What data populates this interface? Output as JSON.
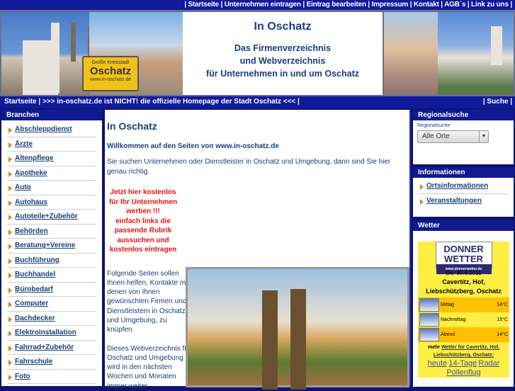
{
  "topnav": [
    "Startseite",
    "Unternehmen eintragen",
    "Eintrag bearbeiten",
    "Impressum",
    "Kontakt",
    "AGB´s",
    "Link zu uns"
  ],
  "header": {
    "title": "In Oschatz",
    "line1": "Das Firmenverzeichnis",
    "line2": "und Webverzeichnis",
    "line3": "für Unternehmen in und um Oschatz",
    "sign_top": "Große Kreisstadt",
    "sign_main": "Oschatz",
    "sign_url": "www.in-oschatz.de"
  },
  "subnav": {
    "home": "Startseite",
    "notice": ">>> in-oschatz.de ist NICHT! die offizielle Homepage der Stadt Oschatz <<<",
    "search": "Suche"
  },
  "branchen": {
    "title": "Branchen",
    "items": [
      "Abschleppdienst",
      "Ärzte",
      "Altenpflege",
      "Apotheke",
      "Auto",
      "Autohaus",
      "Autoteile+Zubehör",
      "Behörden",
      "Beratung+Vereine",
      "Buchführung",
      "Buchhandel",
      "Bürobedarf",
      "Computer",
      "Dachdecker",
      "Elektroinstallation",
      "Fahrrad+Zubehör",
      "Fahrschule",
      "Foto"
    ]
  },
  "main": {
    "title": "In Oschatz",
    "welcome": "Willkommen auf den Seiten von www.in-oschatz.de",
    "intro": "Sie suchen Unternehmen oder Dienstleister in Oschatz und Umgebung, dann sind Sie hier genau richtig.",
    "promo": [
      "Jetzt hier kostenlos",
      "für Ihr Unternehmen",
      "werben !!!",
      "einfach links die",
      "passende Rubrik",
      "aussuchen und",
      "kostenlos eintragen"
    ],
    "para1": "Folgende Seiten sollen Ihnen helfen, Kontakte mit denen von Ihnen gewünschten Firmen und Dienstleistern in Oschatz und Umgebung, zu knüpfen.",
    "para2": "Dieses Webverzeichnis für Oschatz und Umgebung wird in den nächsten Wochen und Monaten immer weiter"
  },
  "regional": {
    "title": "Regionalsuche",
    "label": "Regionalsuche",
    "selected": "Alle Orte"
  },
  "info": {
    "title": "Informationen",
    "items": [
      "Ortsinformationen",
      "Veranstaltungen"
    ]
  },
  "wetter": {
    "title": "Wetter",
    "logo1": "DONNER",
    "logo2": "WETTER",
    "logo_url": "www.donnerwetter.de",
    "date": "Do. 30.6.2011",
    "place": "Cavertitz, Hof, Liebschützberg, Oschatz",
    "rows": [
      {
        "label": "Mittag",
        "temp": "14°C"
      },
      {
        "label": "Nachmittag",
        "temp": "15°C"
      },
      {
        "label": "Abend",
        "temp": "14°C"
      }
    ],
    "more": "mehr",
    "more_link": "Wetter für Cavertitz, Hof, Liebschützberg, Oschatz:",
    "links": [
      "heute",
      "14-Tage",
      "Radar",
      "Pollenflug"
    ]
  }
}
